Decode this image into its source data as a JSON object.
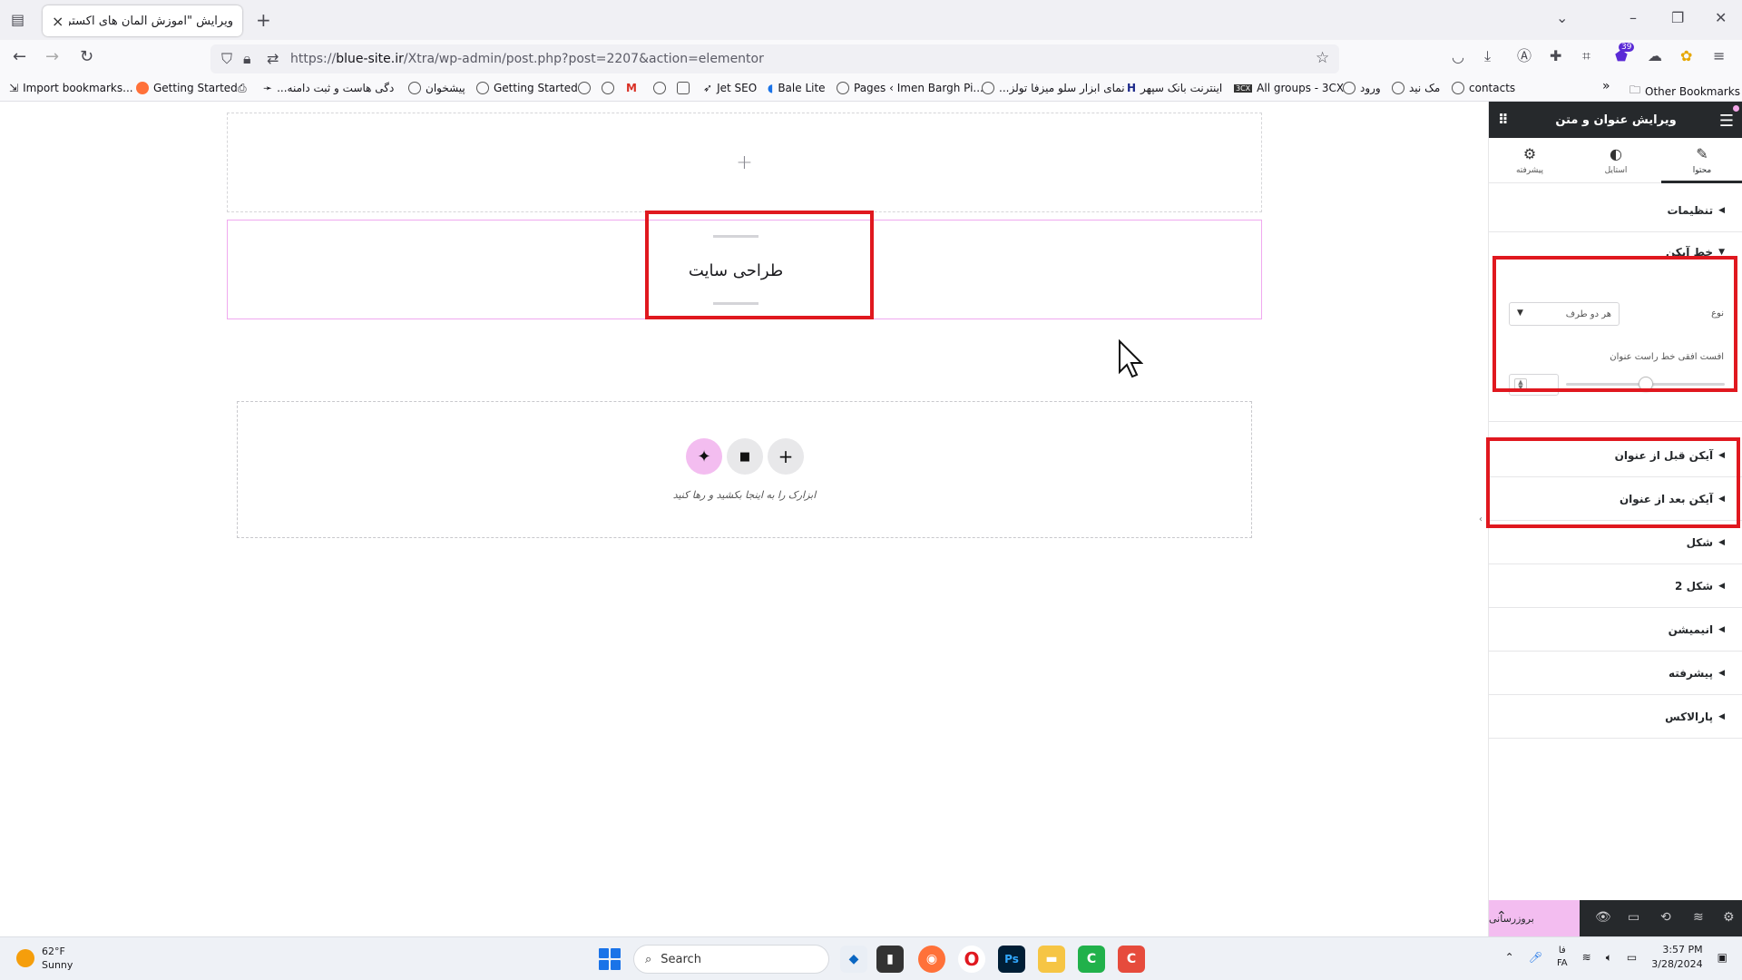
{
  "browser": {
    "tab_title": "ویرایش \"آموزش المان های اکسترا - ...",
    "tab_close": "×",
    "new_tab": "+",
    "url_prefix": "https://",
    "url_domain": "blue-site.ir",
    "url_path": "/Xtra/wp-admin/post.php?post=2207&action=elementor",
    "extension_badge": "39",
    "bookmarks": [
      "Import bookmarks...",
      "Getting Started",
      "...دگی هاست و ثبت دامنه",
      "پیشخوان",
      "Getting Started",
      "Jet SEO",
      "Bale Lite",
      "Pages ‹ Imen Bargh Pi...",
      "...نمای ابزار سلو میزفا تولز",
      "اینترنت بانک سپهر",
      "All groups - 3CX",
      "ورود",
      "مک نید",
      "contacts"
    ],
    "overflow": "»",
    "other_bookmarks": "Other Bookmarks"
  },
  "canvas": {
    "empty_section_plus": "+",
    "heading_text": "طراحی سایت",
    "drop_zone": {
      "ai_button": "✦",
      "folder_button": "■",
      "add_button": "+",
      "hint": "ابزارک را به اینجا بکشید و رها کنید"
    }
  },
  "panel": {
    "title": "ویرایش عنوان و متن",
    "tabs": [
      {
        "label": "محتوا",
        "icon": "pencil-icon",
        "active": true
      },
      {
        "label": "استایل",
        "icon": "contrast-icon",
        "active": false
      },
      {
        "label": "پیشرفته",
        "icon": "gear-icon",
        "active": false
      }
    ],
    "sections": {
      "settings": "تنظیمات",
      "icon_line": "خط آیکن",
      "icon_before": "آیکن قبل از عنوان",
      "icon_after": "آیکن بعد از عنوان",
      "shape": "شکل",
      "shape2": "شکل 2",
      "animation": "انیمیشن",
      "advanced": "پیشرفته",
      "parallax": "پارالاکس"
    },
    "controls": {
      "type_label": "نوع",
      "type_value": "هر دو طرف",
      "offset_label": "افست افقی خط راست عنوان",
      "offset_slider_fraction": 0.5
    },
    "footer": {
      "update_label": "بروزرسانی"
    }
  },
  "taskbar": {
    "temperature": "62°F",
    "condition": "Sunny",
    "search_placeholder": "Search",
    "lang_top": "فا",
    "lang_bottom": "FA",
    "time": "3:57 PM",
    "date": "3/28/2024"
  },
  "colors": {
    "accent_pink": "#f3bdf0",
    "panel_dark": "#26292c",
    "highlight_red": "#e0181f"
  }
}
